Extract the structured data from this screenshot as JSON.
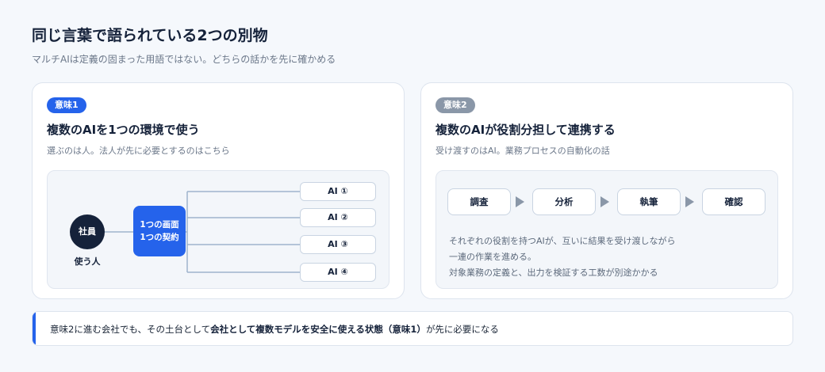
{
  "header": {
    "title": "同じ言葉で語られている2つの別物",
    "subtitle": "マルチAIは定義の固まった用語ではない。どちらの話かを先に確かめる"
  },
  "meaning1": {
    "badge": "意味1",
    "title": "複数のAIを1つの環境で使う",
    "desc": "選ぶのは人。法人が先に必要とするのはこちら",
    "employee": "社員",
    "employee_label": "使う人",
    "screen_line1": "1つの画面",
    "screen_line2": "1つの契約",
    "ai_items": [
      "AI ①",
      "AI ②",
      "AI ③",
      "AI ④"
    ]
  },
  "meaning2": {
    "badge": "意味2",
    "title": "複数のAIが役割分担して連携する",
    "desc": "受け渡すのはAI。業務プロセスの自動化の話",
    "steps": [
      "調査",
      "分析",
      "執筆",
      "確認"
    ],
    "desc_lines": [
      "それぞれの役割を持つAIが、互いに結果を受け渡しながら",
      "一連の作業を進める。",
      "対象業務の定義と、出力を検証する工数が別途かかる"
    ]
  },
  "note": {
    "part1": "意味2に進む会社でも、その土台として",
    "bold": "会社として複数モデルを安全に使える状態（意味1）",
    "part2": "が先に必要になる"
  },
  "colors": {
    "accent": "#2563eb",
    "dark": "#15223a",
    "gray_badge": "#8a97a8"
  }
}
